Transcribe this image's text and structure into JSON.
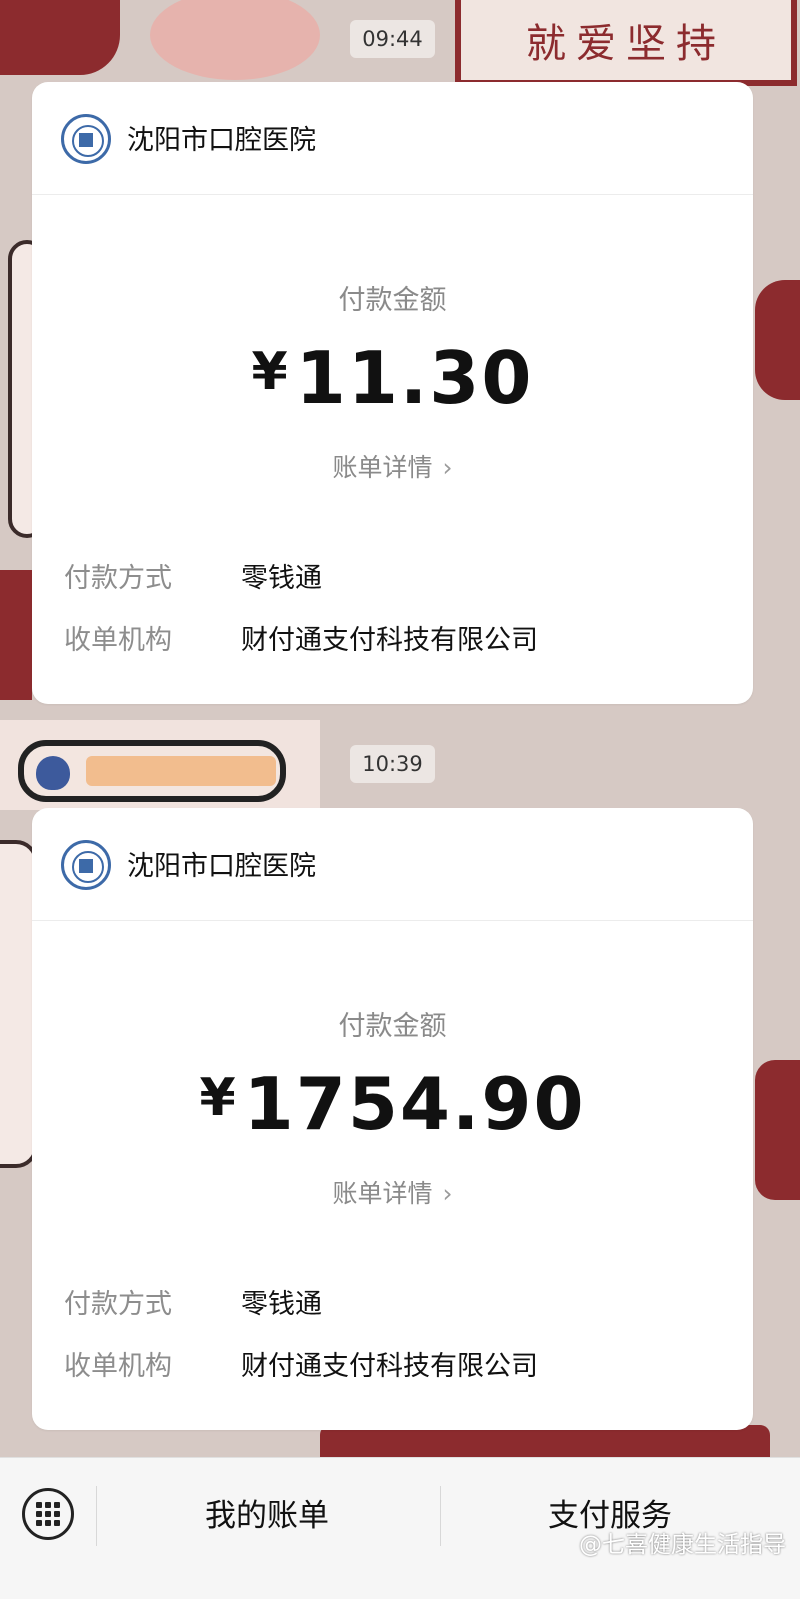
{
  "messages": [
    {
      "time": "09:44",
      "merchant": "沈阳市口腔医院",
      "amount_label": "付款金额",
      "currency": "¥",
      "amount": "11.30",
      "bill_link": "账单详情",
      "rows": [
        {
          "key": "付款方式",
          "value": "零钱通"
        },
        {
          "key": "收单机构",
          "value": "财付通支付科技有限公司"
        }
      ]
    },
    {
      "time": "10:39",
      "merchant": "沈阳市口腔医院",
      "amount_label": "付款金额",
      "currency": "¥",
      "amount": "1754.90",
      "bill_link": "账单详情",
      "rows": [
        {
          "key": "付款方式",
          "value": "零钱通"
        },
        {
          "key": "收单机构",
          "value": "财付通支付科技有限公司"
        }
      ]
    }
  ],
  "bottom_bar": {
    "keyboard_icon": "keyboard-icon",
    "my_bills": "我的账单",
    "payment_service": "支付服务"
  },
  "watermark": "@七喜健康生活指导",
  "wallpaper_text": "就爱坚持",
  "colors": {
    "wallpaper": "#d6c9c4",
    "wallpaper_accent": "#8c2b2e",
    "card": "#ffffff",
    "muted_text": "#8a8a8a"
  }
}
